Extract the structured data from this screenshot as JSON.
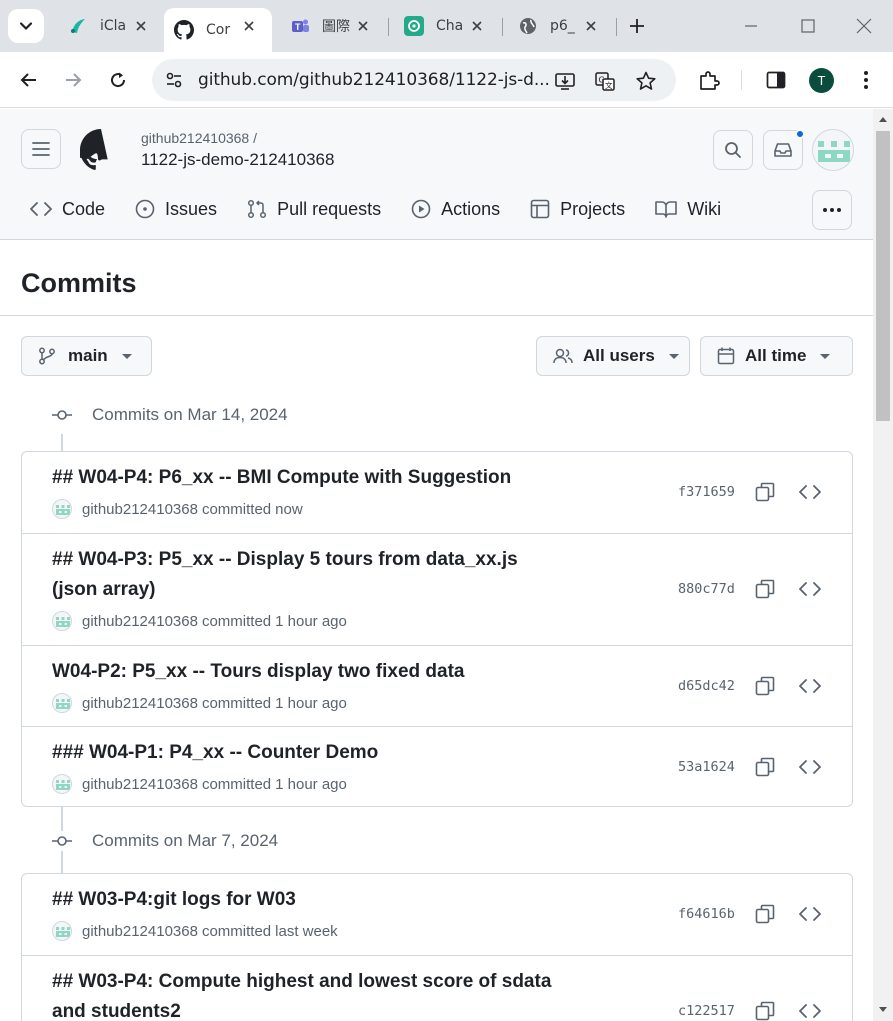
{
  "browser": {
    "tabs": [
      {
        "title": "iCla",
        "icon": "iclass-icon"
      },
      {
        "title": "Cor",
        "icon": "github-icon",
        "active": true
      },
      {
        "title": "圖際",
        "icon": "teams-icon"
      },
      {
        "title": "Cha",
        "icon": "chatgpt-icon"
      },
      {
        "title": "p6_",
        "icon": "globe-icon"
      }
    ],
    "url": "github.com/github212410368/1122-js-d...",
    "profile_initial": "T"
  },
  "repo": {
    "owner": "github212410368 /",
    "name": "1122-js-demo-212410368",
    "nav": [
      {
        "label": "Code",
        "icon": "code-icon"
      },
      {
        "label": "Issues",
        "icon": "issue-icon"
      },
      {
        "label": "Pull requests",
        "icon": "pull-request-icon"
      },
      {
        "label": "Actions",
        "icon": "play-icon"
      },
      {
        "label": "Projects",
        "icon": "table-icon"
      },
      {
        "label": "Wiki",
        "icon": "book-icon"
      }
    ]
  },
  "page": {
    "title": "Commits",
    "branch": "main",
    "users_filter": "All users",
    "time_filter": "All time"
  },
  "groups": [
    {
      "header": "Commits on Mar 14, 2024",
      "commits": [
        {
          "title": "## W04-P4: P6_xx -- BMI Compute with Suggestion",
          "author": "github212410368",
          "action": "committed",
          "when": "now",
          "sha": "f371659"
        },
        {
          "title": "## W04-P3: P5_xx -- Display 5 tours from data_xx.js (json array)",
          "author": "github212410368",
          "action": "committed",
          "when": "1 hour ago",
          "sha": "880c77d"
        },
        {
          "title": "W04-P2: P5_xx -- Tours display two fixed data",
          "author": "github212410368",
          "action": "committed",
          "when": "1 hour ago",
          "sha": "d65dc42"
        },
        {
          "title": "### W04-P1: P4_xx -- Counter Demo",
          "author": "github212410368",
          "action": "committed",
          "when": "1 hour ago",
          "sha": "53a1624"
        }
      ]
    },
    {
      "header": "Commits on Mar 7, 2024",
      "commits": [
        {
          "title": "## W03-P4:git logs for W03",
          "author": "github212410368",
          "action": "committed",
          "when": "last week",
          "sha": "f64616b"
        },
        {
          "title": "## W03-P4: Compute highest and lowest score of sdata and students2",
          "author": "github212410368",
          "action": "committed",
          "when": "",
          "sha": "c122517"
        }
      ]
    }
  ],
  "colors": {
    "accent": "#0969da",
    "border": "#d0d7de",
    "muted_text": "#59636e",
    "identicon": "#8ed7c2"
  }
}
